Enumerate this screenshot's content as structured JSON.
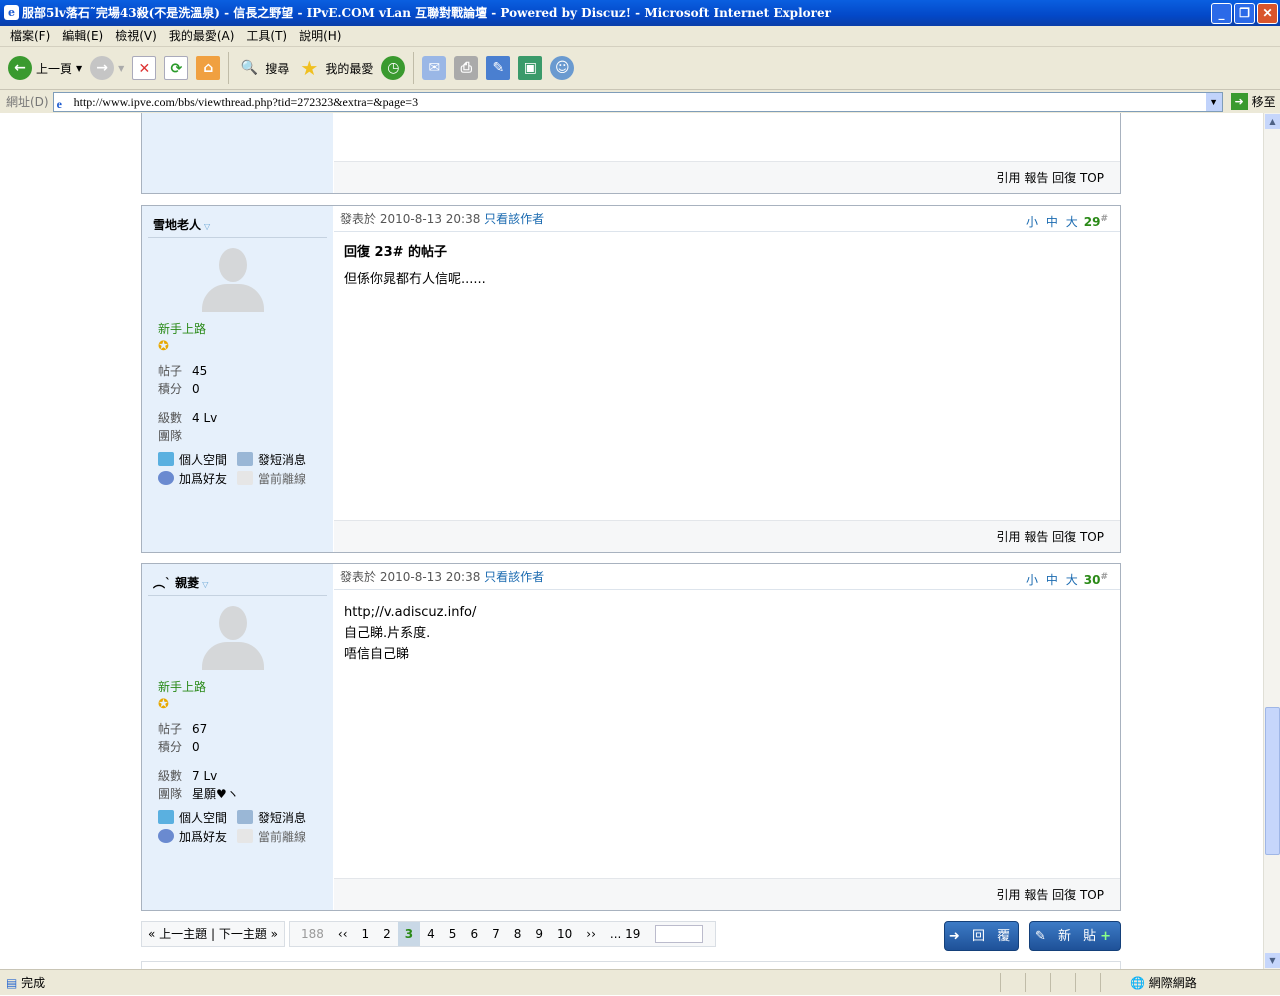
{
  "window": {
    "title": "服部5lv落石˜完場43殺(不是洗溫泉) - 信長之野望 - IPvE.COM vLan 互聯對戰論壇 - Powered by Discuz! - Microsoft Internet Explorer"
  },
  "menu": [
    "檔案(F)",
    "編輯(E)",
    "檢視(V)",
    "我的最愛(A)",
    "工具(T)",
    "說明(H)"
  ],
  "toolbar": {
    "back": "上一頁",
    "search": "搜尋",
    "favorites": "我的最愛"
  },
  "address": {
    "label": "網址(D)",
    "url": "http://www.ipve.com/bbs/viewthread.php?tid=272323&extra=&page=3",
    "go": "移至"
  },
  "post_common": {
    "posted_prefix": "發表於",
    "only_author": "只看該作者",
    "font_small": "小",
    "font_mid": "中",
    "font_large": "大",
    "footer": "引用 報告 回復 TOP",
    "posts_label": "帖子",
    "credits_label": "積分",
    "level_label": "級數",
    "team_label": "團隊",
    "space": "個人空間",
    "pm": "發短消息",
    "add_friend": "加爲好友",
    "offline": "當前離線"
  },
  "posts": [
    {
      "author": "雪地老人",
      "rank": "新手上路",
      "posts": "45",
      "credits": "0",
      "level": "4 Lv",
      "team": "",
      "time": "2010-8-13 20:38",
      "floor": "29",
      "title": "回復 23# 的帖子",
      "lines": [
        "但係你晁都冇人信呢......"
      ]
    },
    {
      "author": "︵ˋ 親菱",
      "rank": "新手上路",
      "posts": "67",
      "credits": "0",
      "level": "7 Lv",
      "team": "星願♥ヽ",
      "time": "2010-8-13 20:38",
      "floor": "30",
      "title": "",
      "lines": [
        "http;//v.adiscuz.info/",
        "自己睇.片系度.",
        "唔信自己睇"
      ]
    }
  ],
  "pager": {
    "prev_next": "« 上一主題 | 下一主題 »",
    "total": "188",
    "first": "‹‹",
    "pages": [
      "1",
      "2",
      "3",
      "4",
      "5",
      "6",
      "7",
      "8",
      "9",
      "10"
    ],
    "current": "3",
    "next": "››",
    "last": "... 19"
  },
  "buttons": {
    "reply": "回 覆",
    "new": "新 貼"
  },
  "status": {
    "text": "完成",
    "zone": "網際網路"
  }
}
